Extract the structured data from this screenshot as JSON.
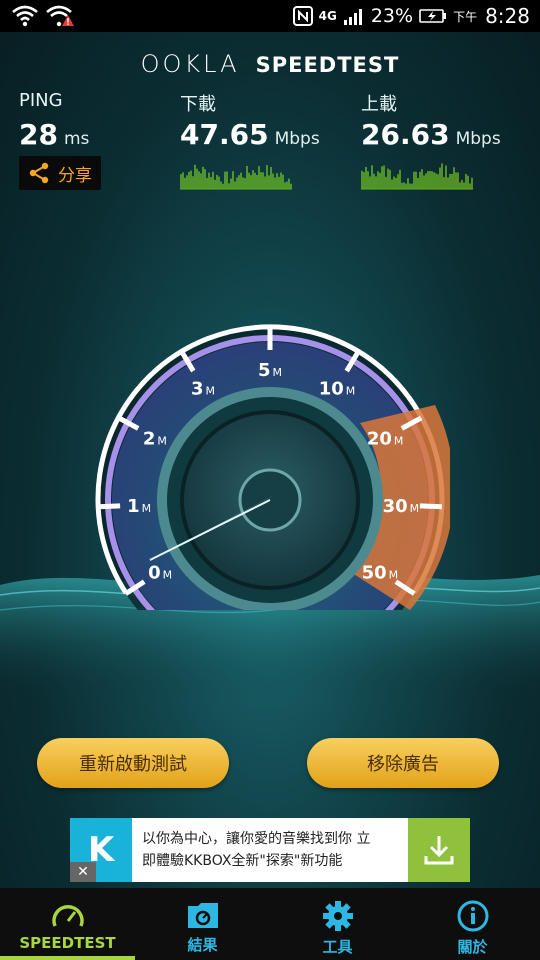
{
  "status_bar": {
    "battery": "23%",
    "ampm": "下午",
    "time": "8:28",
    "network": "4G"
  },
  "header": {
    "brand": "OOKLA",
    "product": "SPEEDTEST"
  },
  "ping": {
    "label": "PING",
    "value": "28",
    "unit": "ms"
  },
  "download": {
    "label": "下載",
    "value": "47.65",
    "unit": "Mbps"
  },
  "upload": {
    "label": "上載",
    "value": "26.63",
    "unit": "Mbps"
  },
  "share": {
    "label": "分享"
  },
  "gauge": {
    "ticks": [
      {
        "n": "0",
        "u": "M"
      },
      {
        "n": "1",
        "u": "M"
      },
      {
        "n": "2",
        "u": "M"
      },
      {
        "n": "3",
        "u": "M"
      },
      {
        "n": "5",
        "u": "M"
      },
      {
        "n": "10",
        "u": "M"
      },
      {
        "n": "20",
        "u": "M"
      },
      {
        "n": "30",
        "u": "M"
      },
      {
        "n": "50",
        "u": "M"
      }
    ],
    "needle_value_mbps": 0.4
  },
  "buttons": {
    "restart": "重新啟動測試",
    "remove_ads": "移除廣告"
  },
  "ad": {
    "line1": "以你為中心，讓你愛的音樂找到你 立",
    "line2": "即體驗KKBOX全新\"探索\"新功能",
    "close": "✕"
  },
  "nav": {
    "items": [
      {
        "label": "SPEEDTEST"
      },
      {
        "label": "結果"
      },
      {
        "label": "工具"
      },
      {
        "label": "關於"
      }
    ]
  },
  "colors": {
    "accent_green": "#a7d63f",
    "accent_blue": "#2fb7e3",
    "button_gold": "#f0b733",
    "share_orange": "#f5a623"
  }
}
